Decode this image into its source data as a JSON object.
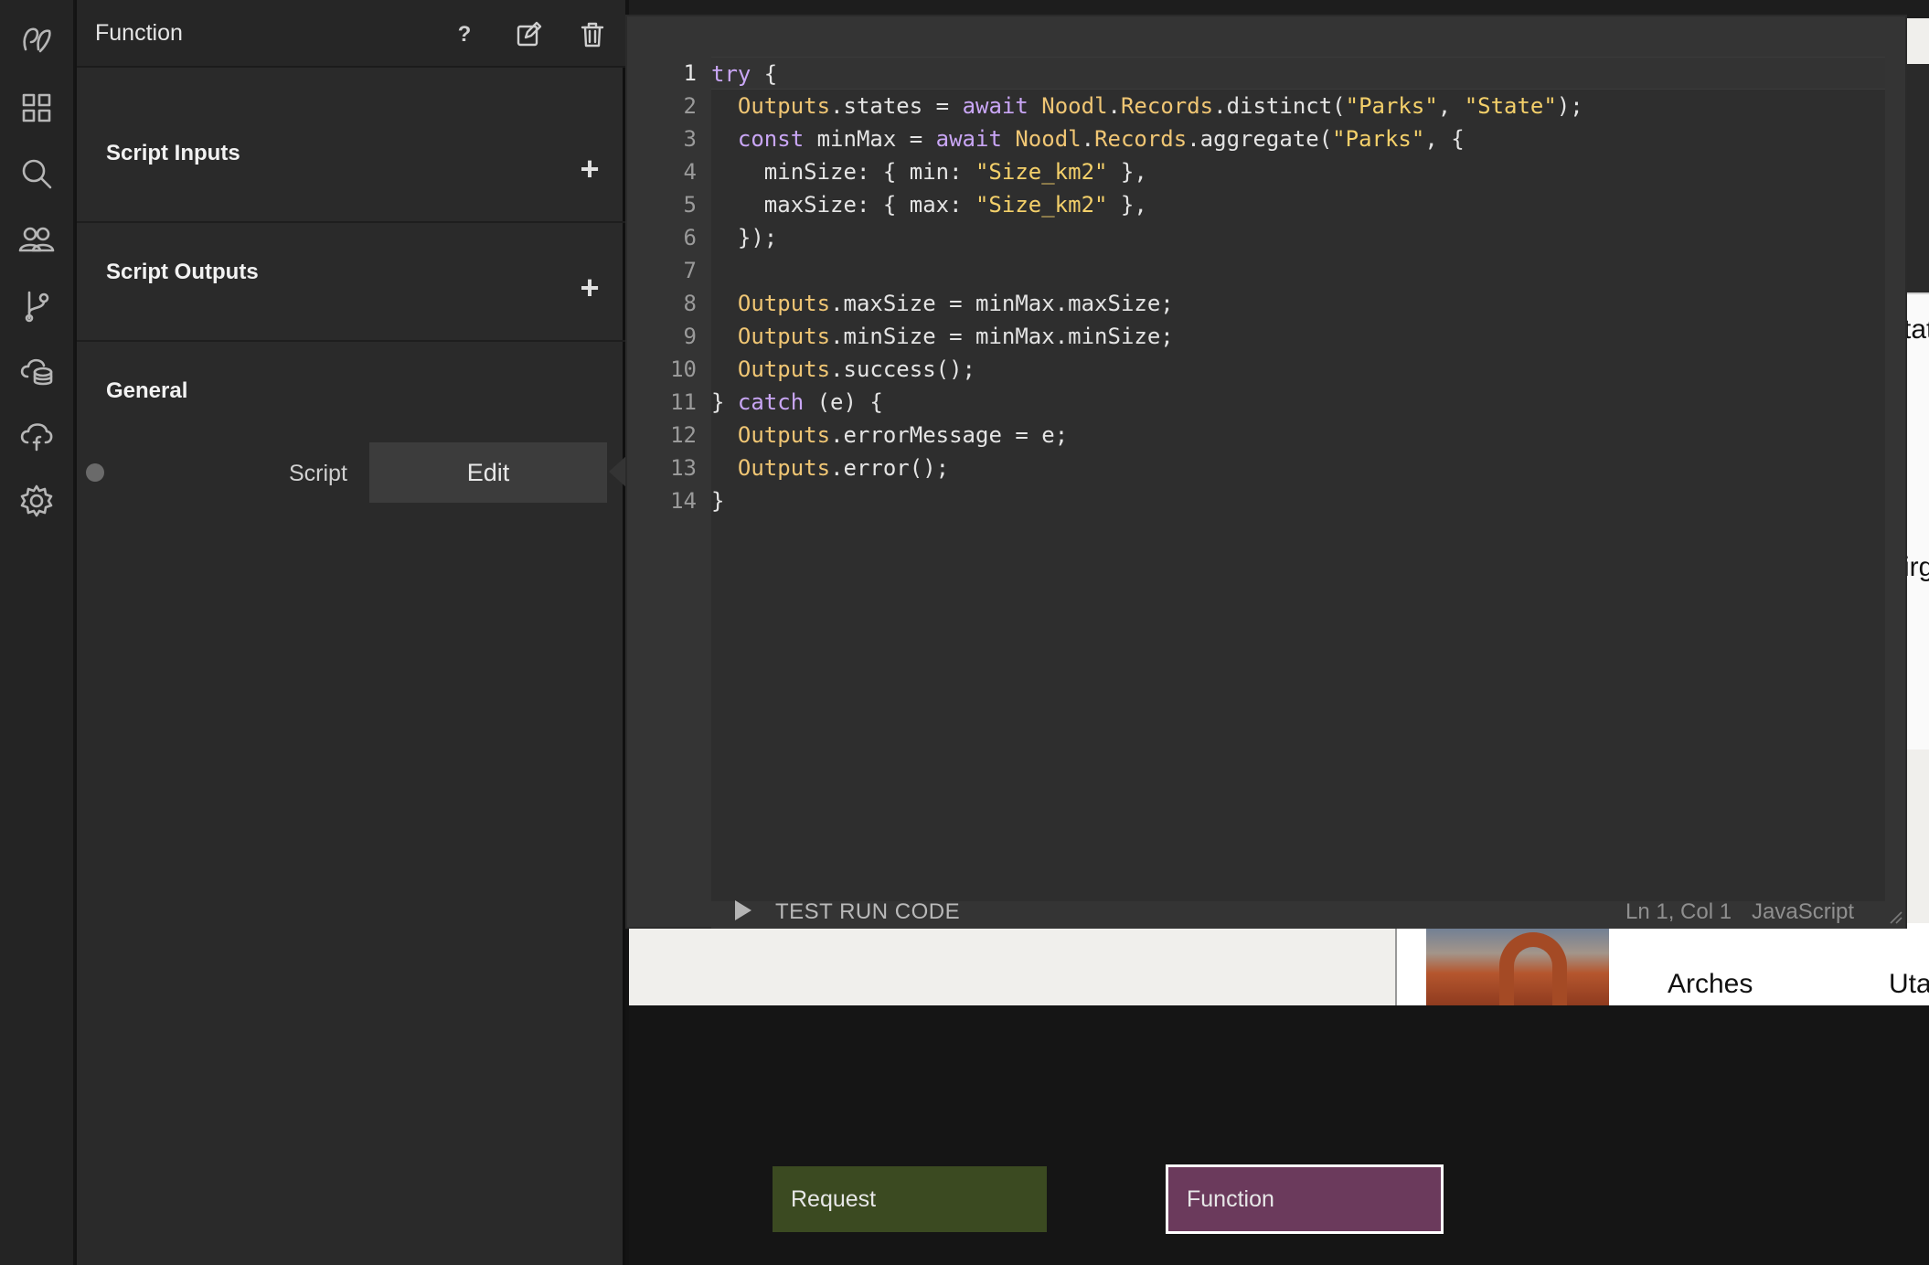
{
  "rail": {
    "icons": [
      "noodl-logo-icon",
      "components-grid-icon",
      "search-icon",
      "users-icon",
      "branch-icon",
      "cloud-database-icon",
      "cloud-function-icon",
      "settings-gear-icon"
    ]
  },
  "panel": {
    "title": "Function",
    "help_glyph": "?",
    "sections": {
      "inputs": "Script Inputs",
      "outputs": "Script Outputs",
      "general": "General"
    },
    "plus_glyph": "+",
    "script_label": "Script",
    "edit_label": "Edit"
  },
  "editor": {
    "line_numbers": [
      "1",
      "2",
      "3",
      "4",
      "5",
      "6",
      "7",
      "8",
      "9",
      "10",
      "11",
      "12",
      "13",
      "14"
    ],
    "test_run_label": "TEST RUN CODE",
    "cursor_position": "Ln 1, Col 1",
    "language": "JavaScript"
  },
  "preview": {
    "item_name": "Arches",
    "item_state": "Uta",
    "cut_text_1": "tat",
    "cut_text_2": "irg"
  },
  "nodes": {
    "request_label": "Request",
    "function_label": "Function"
  },
  "colors": {
    "keyword": "#c9a6f5",
    "object": "#f0c674",
    "string": "#f4d06a",
    "request_node": "#3b4a21",
    "function_node": "#6b3a5c"
  }
}
